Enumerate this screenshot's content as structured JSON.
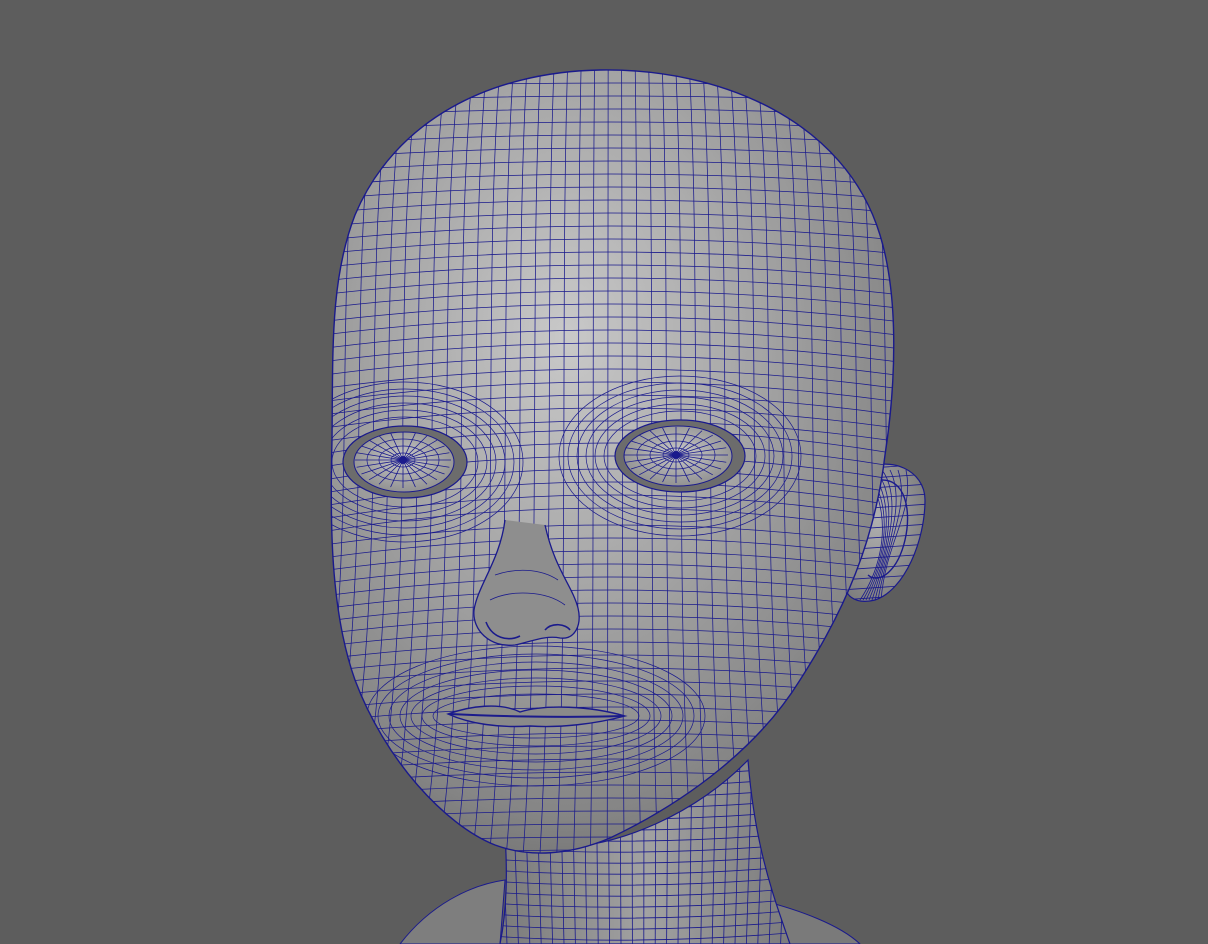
{
  "viewport": {
    "background_color": "#5d5d5d",
    "shading": "smooth-shaded-with-wireframe-on-shaded",
    "wireframe_color": "#1a1a8c",
    "surface_color": "#9a9a9a",
    "model": "stylized-character-head-mesh"
  }
}
